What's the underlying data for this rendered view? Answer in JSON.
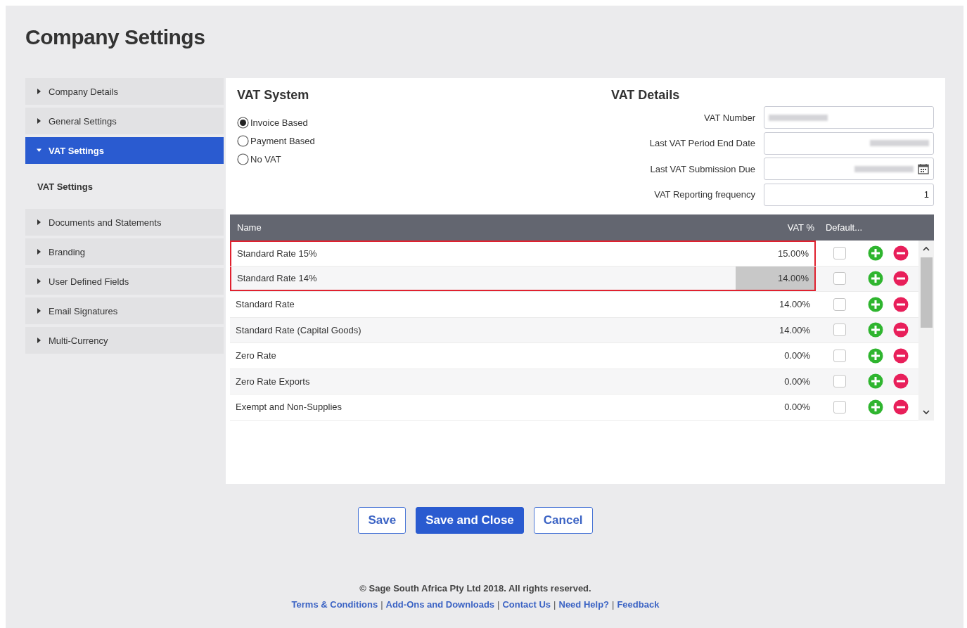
{
  "page_title": "Company Settings",
  "sidebar": {
    "items": [
      {
        "label": "Company Details",
        "expanded": false,
        "selected": false
      },
      {
        "label": "General Settings",
        "expanded": false,
        "selected": false
      },
      {
        "label": "VAT Settings",
        "expanded": true,
        "selected": true,
        "children": [
          {
            "label": "VAT Settings"
          }
        ]
      },
      {
        "label": "Documents and Statements",
        "expanded": false,
        "selected": false
      },
      {
        "label": "Branding",
        "expanded": false,
        "selected": false
      },
      {
        "label": "User Defined Fields",
        "expanded": false,
        "selected": false
      },
      {
        "label": "Email Signatures",
        "expanded": false,
        "selected": false
      },
      {
        "label": "Multi-Currency",
        "expanded": false,
        "selected": false
      }
    ]
  },
  "vat_system": {
    "title": "VAT System",
    "options": [
      {
        "label": "Invoice Based",
        "selected": true
      },
      {
        "label": "Payment Based",
        "selected": false
      },
      {
        "label": "No VAT",
        "selected": false
      }
    ]
  },
  "vat_details": {
    "title": "VAT Details",
    "fields": [
      {
        "label": "VAT Number",
        "kind": "redacted_text"
      },
      {
        "label": "Last VAT Period End Date",
        "kind": "redacted_date"
      },
      {
        "label": "Last VAT Submission Due",
        "kind": "redacted_date_picker"
      },
      {
        "label": "VAT Reporting frequency",
        "kind": "text",
        "value": "1"
      }
    ]
  },
  "table": {
    "columns": [
      "Name",
      "VAT %",
      "Default..."
    ],
    "rows": [
      {
        "name": "Standard Rate 15%",
        "vat": "15.00%",
        "default": false,
        "highlighted": true,
        "editing": false
      },
      {
        "name": "Standard Rate 14%",
        "vat": "14.00%",
        "default": false,
        "highlighted": true,
        "editing": true
      },
      {
        "name": "Standard Rate",
        "vat": "14.00%",
        "default": false,
        "highlighted": false,
        "editing": false
      },
      {
        "name": "Standard Rate (Capital Goods)",
        "vat": "14.00%",
        "default": false,
        "highlighted": false,
        "editing": false
      },
      {
        "name": "Zero Rate",
        "vat": "0.00%",
        "default": false,
        "highlighted": false,
        "editing": false
      },
      {
        "name": "Zero Rate Exports",
        "vat": "0.00%",
        "default": false,
        "highlighted": false,
        "editing": false
      },
      {
        "name": "Exempt and Non-Supplies",
        "vat": "0.00%",
        "default": false,
        "highlighted": false,
        "editing": false
      }
    ]
  },
  "buttons": [
    {
      "label": "Save",
      "kind": "secondary"
    },
    {
      "label": "Save and Close",
      "kind": "primary"
    },
    {
      "label": "Cancel",
      "kind": "secondary"
    }
  ],
  "footer": {
    "copyright": "© Sage South Africa Pty Ltd 2018. All rights reserved.",
    "links": [
      {
        "kind": "link",
        "text": "Terms & Conditions"
      },
      {
        "kind": "separator",
        "text": "|"
      },
      {
        "kind": "link",
        "text": "Add-Ons and Downloads"
      },
      {
        "kind": "separator",
        "text": "|"
      },
      {
        "kind": "link",
        "text": "Contact Us"
      },
      {
        "kind": "separator",
        "text": "|"
      },
      {
        "kind": "link",
        "text": "Need Help?"
      },
      {
        "kind": "separator",
        "text": "|"
      },
      {
        "kind": "link",
        "text": "Feedback"
      }
    ]
  }
}
